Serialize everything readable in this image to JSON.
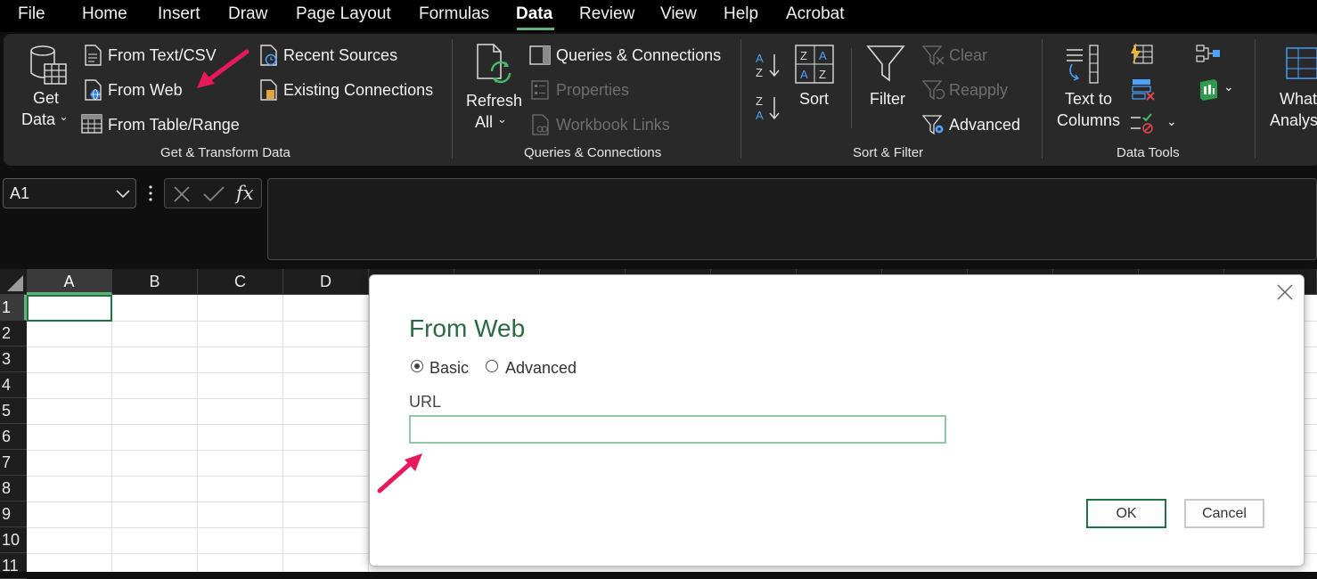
{
  "menu": {
    "tabs": [
      {
        "label": "File"
      },
      {
        "label": "Home"
      },
      {
        "label": "Insert"
      },
      {
        "label": "Draw"
      },
      {
        "label": "Page Layout"
      },
      {
        "label": "Formulas"
      },
      {
        "label": "Data",
        "active": true
      },
      {
        "label": "Review"
      },
      {
        "label": "View"
      },
      {
        "label": "Help"
      },
      {
        "label": "Acrobat"
      }
    ]
  },
  "ribbon": {
    "get_transform": {
      "get_data_line1": "Get",
      "get_data_line2": "Data",
      "from_text_csv": "From Text/CSV",
      "from_web": "From Web",
      "from_table_range": "From Table/Range",
      "recent_sources": "Recent Sources",
      "existing_connections": "Existing Connections",
      "group_label": "Get & Transform Data"
    },
    "queries": {
      "refresh_line1": "Refresh",
      "refresh_line2": "All",
      "queries_connections": "Queries & Connections",
      "properties": "Properties",
      "workbook_links": "Workbook Links",
      "group_label": "Queries & Connections"
    },
    "sort_filter": {
      "sort": "Sort",
      "filter": "Filter",
      "clear": "Clear",
      "reapply": "Reapply",
      "advanced": "Advanced",
      "group_label": "Sort & Filter"
    },
    "data_tools": {
      "text_to_columns_line1": "Text to",
      "text_to_columns_line2": "Columns",
      "group_label": "Data Tools"
    },
    "forecast": {
      "what_if_line1": "What-If",
      "what_if_line2": "Analysis"
    }
  },
  "formula_bar": {
    "name_box": "A1",
    "fx": "fx",
    "formula": ""
  },
  "sheet": {
    "columns": [
      "A",
      "B",
      "C",
      "D"
    ],
    "rows": [
      "1",
      "2",
      "3",
      "4",
      "5",
      "6",
      "7",
      "8",
      "9",
      "10",
      "11"
    ],
    "active_cell": "A1"
  },
  "dialog": {
    "title": "From Web",
    "radio_basic": "Basic",
    "radio_advanced": "Advanced",
    "selected_mode": "Basic",
    "url_label": "URL",
    "url_value": "",
    "ok": "OK",
    "cancel": "Cancel"
  },
  "colors": {
    "accent_green": "#1f7346",
    "tab_underline": "#62b37a",
    "annotation_arrow": "#e8185c"
  }
}
